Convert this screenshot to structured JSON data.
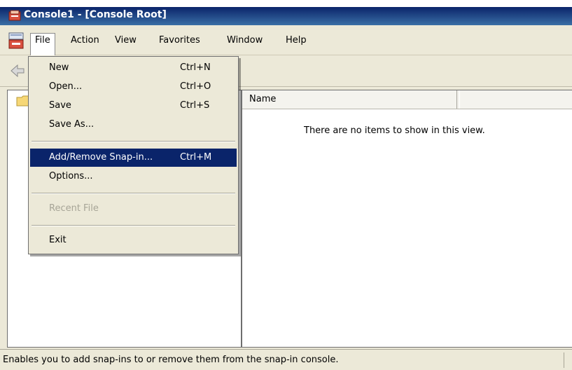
{
  "window": {
    "title": "Console1 - [Console Root]"
  },
  "menubar": {
    "items": [
      {
        "label": "File",
        "active": true
      },
      {
        "label": "Action"
      },
      {
        "label": "View"
      },
      {
        "label": "Favorites"
      },
      {
        "label": "Window"
      },
      {
        "label": "Help"
      }
    ]
  },
  "file_menu": {
    "items": [
      {
        "label": "New",
        "shortcut": "Ctrl+N"
      },
      {
        "label": "Open...",
        "shortcut": "Ctrl+O"
      },
      {
        "label": "Save",
        "shortcut": "Ctrl+S"
      },
      {
        "label": "Save As...",
        "shortcut": ""
      },
      {
        "label": "Add/Remove Snap-in...",
        "shortcut": "Ctrl+M",
        "highlighted": true
      },
      {
        "label": "Options...",
        "shortcut": ""
      },
      {
        "label": "Recent File",
        "shortcut": "",
        "disabled": true
      },
      {
        "label": "Exit",
        "shortcut": ""
      }
    ]
  },
  "list_view": {
    "columns": [
      "Name"
    ],
    "empty_message": "There are no items to show in this view."
  },
  "statusbar": {
    "text": "Enables you to add snap-ins to or remove them from the snap-in console."
  },
  "colors": {
    "titlebar": "#0a246a",
    "menu_highlight": "#0a246a",
    "chrome": "#ece9d8"
  }
}
